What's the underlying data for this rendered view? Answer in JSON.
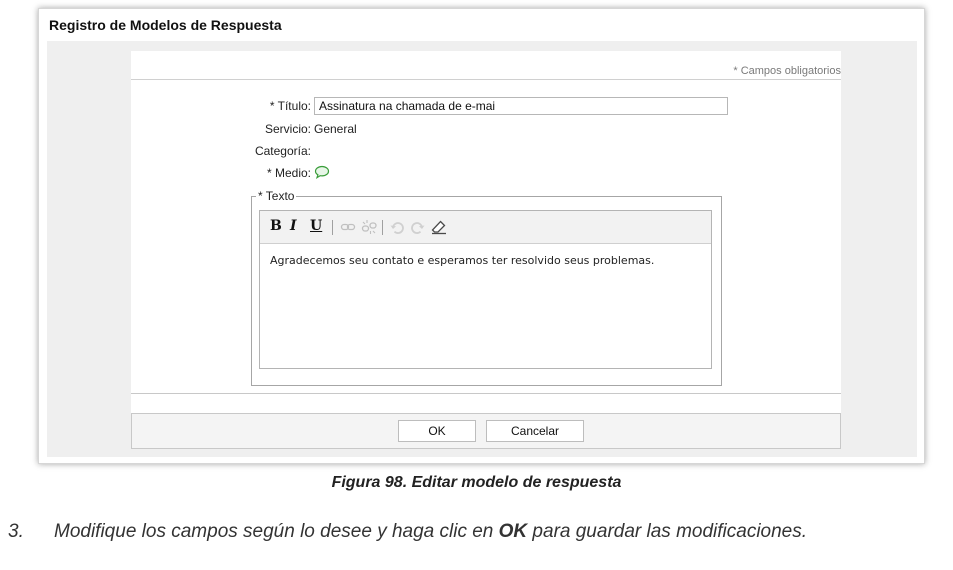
{
  "panel": {
    "title": "Registro de Modelos de Respuesta"
  },
  "form": {
    "required_note": "* Campos obligatorios",
    "titulo_label": "* Título:",
    "titulo_value": "Assinatura na chamada de e-mai",
    "servicio_label": "Servicio:",
    "servicio_value": "General",
    "categoria_label": "Categoría:",
    "medio_label": "* Medio:",
    "medio_icon": "speech-bubble-icon",
    "texto_legend": "* Texto",
    "editor": {
      "toolbar": {
        "bold": "B",
        "italic": "I",
        "underline": "U"
      },
      "content": "Agradecemos seu contato e esperamos ter resolvido seus problemas."
    }
  },
  "buttons": {
    "ok": "OK",
    "cancel": "Cancelar"
  },
  "caption": "Figura 98. Editar modelo de respuesta",
  "step": {
    "number": "3.",
    "text_prefix": "Modifique los campos según lo desee y haga clic en ",
    "text_bold": "OK",
    "text_suffix": " para guardar las modificaciones."
  },
  "colors": {
    "panel_bg": "#efefef",
    "border": "#c8c8c8",
    "icon_green": "#3a9d3a"
  }
}
